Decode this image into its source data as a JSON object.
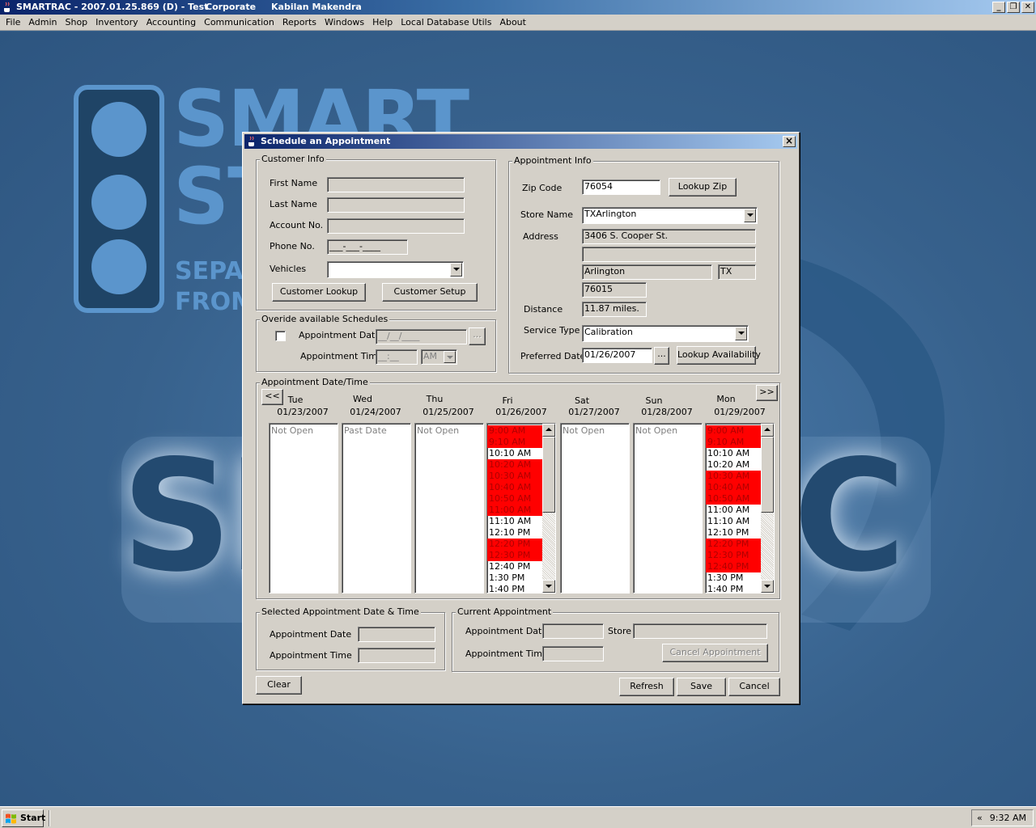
{
  "app": {
    "title_name": "SMARTRAC - 2007.01.25.869 (D) - Test",
    "title_location": "Corporate",
    "title_user": "Kabilan Makendra",
    "window_buttons": [
      "_",
      "❐",
      "✕"
    ]
  },
  "menu": [
    "File",
    "Admin",
    "Shop",
    "Inventory",
    "Accounting",
    "Communication",
    "Reports",
    "Windows",
    "Help",
    "Local Database Utils",
    "About"
  ],
  "dialog": {
    "title": "Schedule an Appointment",
    "customer_info": {
      "legend": "Customer Info",
      "first_name_label": "First Name",
      "last_name_label": "Last Name",
      "account_label": "Account No.",
      "phone_label": "Phone No.",
      "phone_mask": "___-___-____",
      "vehicles_label": "Vehicles",
      "customer_lookup": "Customer Lookup",
      "customer_setup": "Customer Setup"
    },
    "override": {
      "legend": "Overide available Schedules",
      "date_label": "Appointment Date",
      "date_mask": "__/__/____",
      "date_button": "...",
      "time_label": "Appointment Time",
      "time_mask": "__:__",
      "ampm": "AM"
    },
    "appointment_info": {
      "legend": "Appointment Info",
      "zip_label": "Zip Code",
      "zip_value": "76054",
      "lookup_zip": "Lookup Zip",
      "store_label": "Store Name",
      "store_value": "TXArlington",
      "address_label": "Address",
      "address_line1": "3406 S. Cooper St.",
      "address_line2": "",
      "city": "Arlington",
      "state": "TX",
      "zip": "76015",
      "distance_label": "Distance",
      "distance_value": "11.87 miles.",
      "service_label": "Service Type",
      "service_value": "Calibration",
      "preferred_label": "Preferred Date",
      "preferred_value": "01/26/2007",
      "date_button": "...",
      "lookup_availability": "Lookup Availability"
    },
    "calendar": {
      "legend": "Appointment Date/Time",
      "prev": "<<",
      "next": ">>",
      "days": [
        {
          "name": "Tue",
          "date": "01/23/2007",
          "message": "Not Open"
        },
        {
          "name": "Wed",
          "date": "01/24/2007",
          "message": "Past Date"
        },
        {
          "name": "Thu",
          "date": "01/25/2007",
          "message": "Not Open"
        },
        {
          "name": "Fri",
          "date": "01/26/2007",
          "message": ""
        },
        {
          "name": "Sat",
          "date": "01/27/2007",
          "message": "Not Open"
        },
        {
          "name": "Sun",
          "date": "01/28/2007",
          "message": "Not Open"
        },
        {
          "name": "Mon",
          "date": "01/29/2007",
          "message": ""
        }
      ],
      "fri_slots": [
        {
          "time": "9:00 AM",
          "busy": true
        },
        {
          "time": "9:10 AM",
          "busy": true
        },
        {
          "time": "10:10 AM",
          "busy": false
        },
        {
          "time": "10:20 AM",
          "busy": true
        },
        {
          "time": "10:30 AM",
          "busy": true
        },
        {
          "time": "10:40 AM",
          "busy": true
        },
        {
          "time": "10:50 AM",
          "busy": true
        },
        {
          "time": "11:00 AM",
          "busy": true
        },
        {
          "time": "11:10 AM",
          "busy": false
        },
        {
          "time": "12:10 PM",
          "busy": false
        },
        {
          "time": "12:20 PM",
          "busy": true
        },
        {
          "time": "12:30 PM",
          "busy": true
        },
        {
          "time": "12:40 PM",
          "busy": false
        },
        {
          "time": "1:30 PM",
          "busy": false
        },
        {
          "time": "1:40 PM",
          "busy": false
        }
      ],
      "mon_slots": [
        {
          "time": "9:00 AM",
          "busy": true
        },
        {
          "time": "9:10 AM",
          "busy": true
        },
        {
          "time": "10:10 AM",
          "busy": false
        },
        {
          "time": "10:20 AM",
          "busy": false
        },
        {
          "time": "10:30 AM",
          "busy": true
        },
        {
          "time": "10:40 AM",
          "busy": true
        },
        {
          "time": "10:50 AM",
          "busy": true
        },
        {
          "time": "11:00 AM",
          "busy": false
        },
        {
          "time": "11:10 AM",
          "busy": false
        },
        {
          "time": "12:10 PM",
          "busy": false
        },
        {
          "time": "12:20 PM",
          "busy": true
        },
        {
          "time": "12:30 PM",
          "busy": true
        },
        {
          "time": "12:40 PM",
          "busy": true
        },
        {
          "time": "1:30 PM",
          "busy": false
        },
        {
          "time": "1:40 PM",
          "busy": false
        }
      ]
    },
    "selected": {
      "legend": "Selected Appointment Date & Time",
      "date_label": "Appointment Date",
      "time_label": "Appointment Time"
    },
    "current": {
      "legend": "Current Appointment",
      "date_label": "Appointment Date",
      "store_label": "Store",
      "time_label": "Appointment Time",
      "cancel": "Cancel Appointment"
    },
    "buttons": {
      "clear": "Clear",
      "refresh": "Refresh",
      "save": "Save",
      "cancel": "Cancel"
    }
  },
  "taskbar": {
    "start": "Start",
    "tray_chevron": "«",
    "clock": "9:32 AM"
  },
  "colors": {
    "busy": "#ff0000",
    "busy_text": "#b00000",
    "dialog": "#d4d0c8",
    "desktop": "#37618c"
  }
}
